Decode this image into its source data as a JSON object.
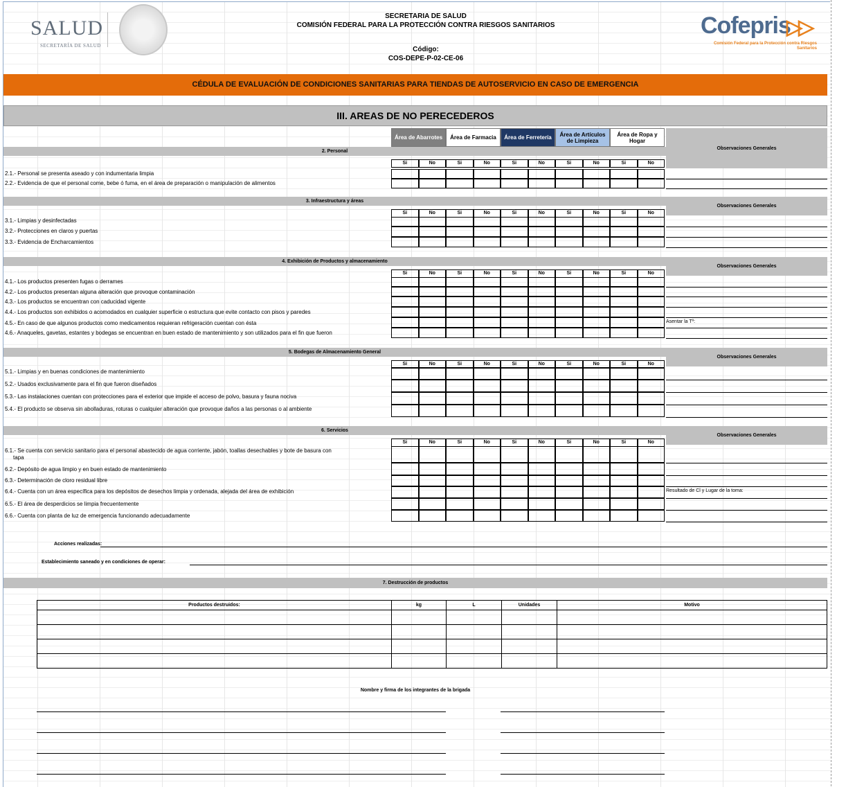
{
  "header": {
    "salud_logo": "SALUD",
    "salud_sub": "SECRETARÍA DE SALUD",
    "line1": "SECRETARIA DE SALUD",
    "line2": "COMISIÓN FEDERAL PARA LA PROTECCIÓN CONTRA RIESGOS SANITARIOS",
    "codigo_label": "Código:",
    "codigo": "COS-DEPE-P-02-CE-06",
    "cofepris": "Cofepris",
    "cofepris_sub": "Comisión Federal para la Protección contra Riesgos Sanitarios"
  },
  "title": "CÉDULA DE EVALUACIÓN DE CONDICIONES SANITARIAS  PARA TIENDAS DE AUTOSERVICIO EN CASO DE EMERGENCIA",
  "section_title": "III.  AREAS DE NO PERECEDEROS",
  "areas": [
    {
      "label": "Área de Abarrotes",
      "bg": "#808080",
      "fg": "#ffffff"
    },
    {
      "label": "Área de Farmacia",
      "bg": "#ffffff",
      "fg": "#000000"
    },
    {
      "label": "Área de Ferretería",
      "bg": "#1f3864",
      "fg": "#ffffff"
    },
    {
      "label": "Área de Artículos de Limpieza",
      "bg": "#a6c2e6",
      "fg": "#000000"
    },
    {
      "label": "Área de Ropa y Hogar",
      "bg": "#ffffff",
      "fg": "#000000"
    }
  ],
  "si": "Si",
  "no": "No",
  "obs_label": "Observaciones Generales",
  "sections": [
    {
      "title": "2. Personal",
      "items": [
        "2.1.- Personal se presenta aseado  y con indumentaria limpia",
        "2.2.- Evidencia de que el personal come, bebe ó fuma, en el área de preparación  o manipulación de alimentos"
      ]
    },
    {
      "title": "3. Infraestructura y áreas",
      "items": [
        "3.1.- Limpias y desinfectadas",
        "3.2.- Protecciones en claros y puertas",
        "3.3.- Evidencia de Encharcamientos"
      ]
    },
    {
      "title": "4. Exhibición de Productos y almacenamiento",
      "items": [
        "4.1.- Los productos  presenten fugas o derrames",
        "4.2.- Los productos presentan alguna alteración que provoque contaminación",
        "4.3.- Los productos se encuentran con caducidad vigente",
        "4.4.- Los productos son exhibidos o acomodados en cualquier superficie o estructura que evite contacto con pisos y paredes",
        "4.5.- En caso de que algunos productos como medicamentos requieran refrigeración cuentan con ésta",
        "4.6.- Anaqueles, gavetas, estantes y bodegas se encuentran en buen estado de mantenimiento y son utilizados para el fin que fueron"
      ],
      "note": "Asentar la Tº:"
    },
    {
      "title": "5. Bodegas de Almacenamiento General",
      "items": [
        "5.1.- Limpias y en buenas condiciones de mantenimiento",
        "5.2.- Usados exclusivamente para el fin que fueron diseñados",
        "5.3.- Las instalaciones cuentan con protecciones para el exterior que impide el acceso de polvo, basura y fauna nociva",
        "5.4.- El producto se observa sin abolladuras, roturas o cualquier alteración que provoque daños a las personas o al ambiente"
      ]
    },
    {
      "title": "6. Servicios",
      "items": [
        "6.1.- Se cuenta con servicio sanitario para el personal abastecido de agua corriente, jabón, toallas desechables y bote de basura con",
        "tapa",
        "6.2.- Depósito de agua limpio y en buen estado de mantenimiento",
        "6.3.- Determinación de cloro residual libre",
        "6.4.- Cuenta con un área específica para los depósitos de desechos limpia y ordenada, alejada del área de exhibición",
        "6.5.- El área de desperdicios se limpia frecuentemente",
        "6.6.- Cuenta con planta de luz de emergencia funcionando adecuadamente"
      ],
      "note": "Resultado de Cl y Lugar de la toma:"
    }
  ],
  "acciones": "Acciones realizadas:",
  "establecimiento": "Establecimiento saneado y en condiciones de operar:",
  "destruccion": {
    "title": "7. Destrucción de productos",
    "columns": [
      "Productos destruidos:",
      "kg",
      "L",
      "Unidades",
      "Motivo"
    ]
  },
  "brigada": "Nombre y firma de los integrantes de la brigada"
}
